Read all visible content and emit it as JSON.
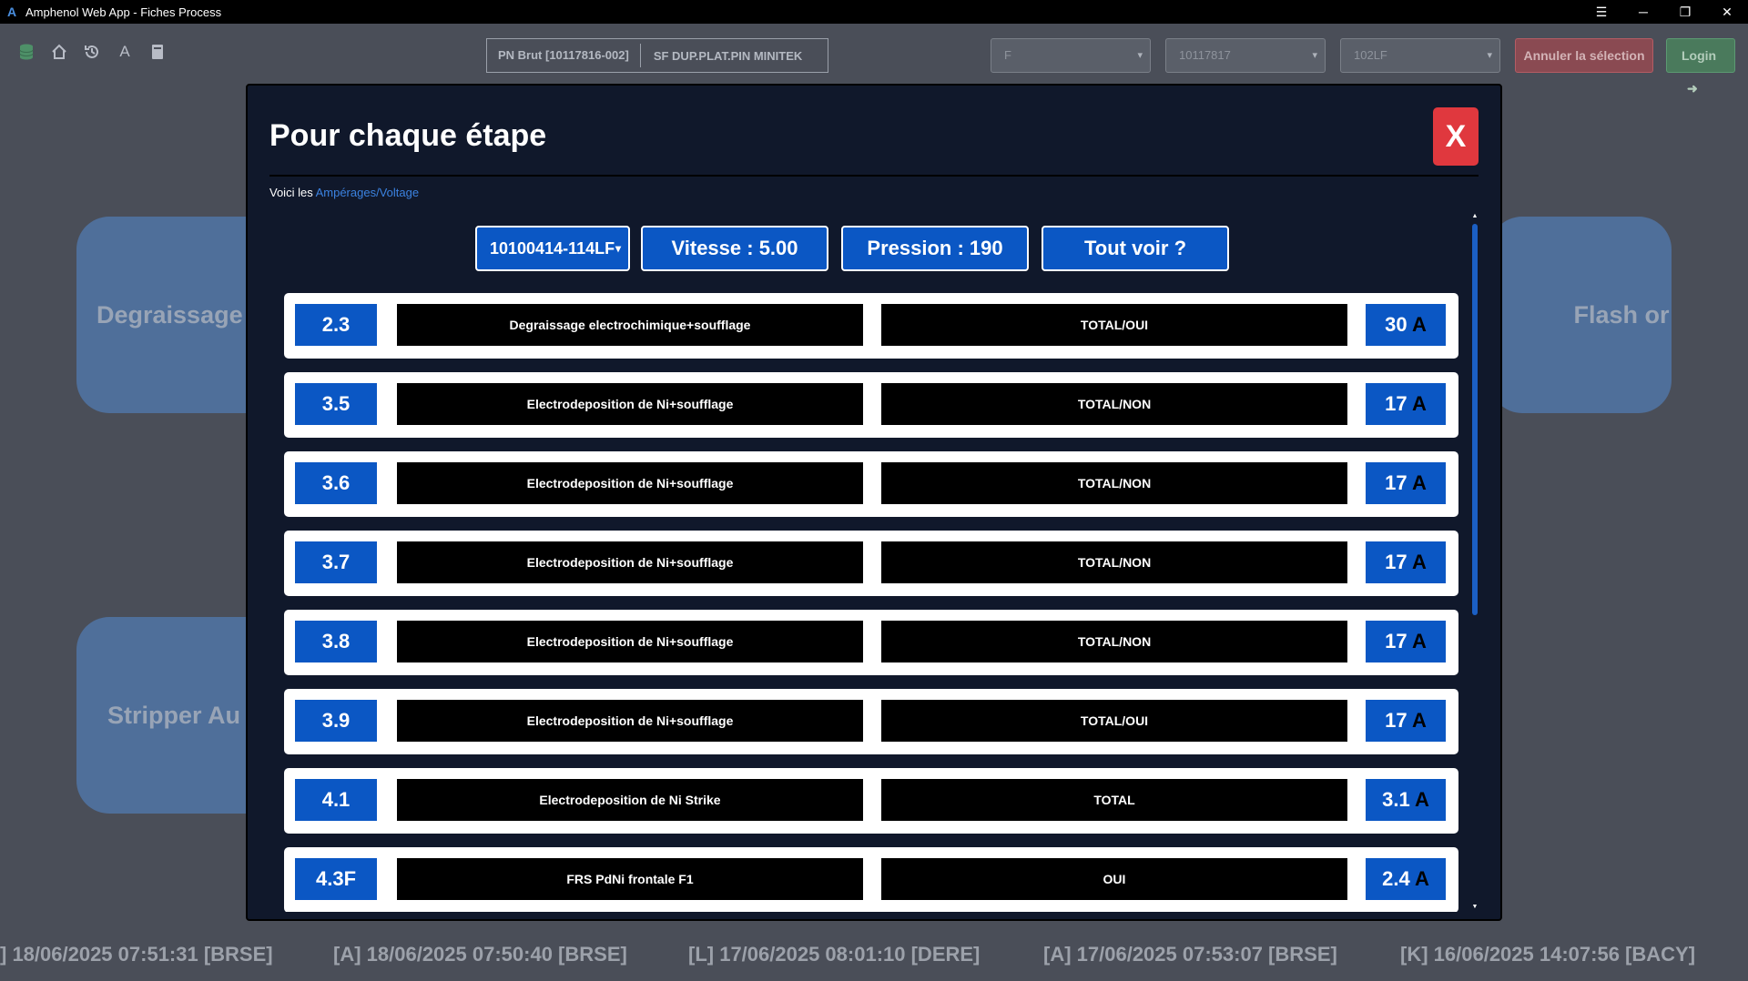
{
  "window": {
    "title": "Amphenol Web App - Fiches Process",
    "logo": "A"
  },
  "toolbar": {
    "icons": [
      "database-icon",
      "home-icon",
      "history-icon",
      "font-icon",
      "book-icon"
    ],
    "font_icon_label": "A",
    "pn_brut": "PN Brut [10117816-002]",
    "pn_desc": "SF DUP.PLAT.PIN MINITEK",
    "select_1": "F",
    "select_2": "10117817",
    "select_3": "102LF",
    "annuler_label": "Annuler la sélection",
    "login_label": "Login"
  },
  "background_cards": {
    "degraissage": "Degraissage",
    "stripper": "Stripper Au",
    "flash": "Flash or"
  },
  "ticker": [
    "] 18/06/2025 07:51:31 [BRSE]",
    "[A] 18/06/2025 07:50:40 [BRSE]",
    "[L] 17/06/2025 08:01:10 [DERE]",
    "[A] 17/06/2025 07:53:07 [BRSE]",
    "[K] 16/06/2025 14:07:56 [BACY]"
  ],
  "modal": {
    "title": "Pour chaque étape",
    "close_label": "X",
    "intro_text": "Voici les ",
    "intro_link": "Ampérages/Voltage",
    "dropdown_value": "10100414-114LF",
    "vitesse": "Vitesse : 5.00",
    "pression": "Pression : 190",
    "tout_voir": "Tout voir ?",
    "amp_unit": "A",
    "rows": [
      {
        "num": "2.3",
        "desc": "Degraissage electrochimique+soufflage",
        "mode": "TOTAL/OUI",
        "amp": "30"
      },
      {
        "num": "3.5",
        "desc": "Electrodeposition de Ni+soufflage",
        "mode": "TOTAL/NON",
        "amp": "17"
      },
      {
        "num": "3.6",
        "desc": "Electrodeposition de Ni+soufflage",
        "mode": "TOTAL/NON",
        "amp": "17"
      },
      {
        "num": "3.7",
        "desc": "Electrodeposition de Ni+soufflage",
        "mode": "TOTAL/NON",
        "amp": "17"
      },
      {
        "num": "3.8",
        "desc": "Electrodeposition de Ni+soufflage",
        "mode": "TOTAL/NON",
        "amp": "17"
      },
      {
        "num": "3.9",
        "desc": "Electrodeposition de Ni+soufflage",
        "mode": "TOTAL/OUI",
        "amp": "17"
      },
      {
        "num": "4.1",
        "desc": "Electrodeposition de Ni Strike",
        "mode": "TOTAL",
        "amp": "3.1"
      },
      {
        "num": "4.3F",
        "desc": "FRS PdNi frontale F1",
        "mode": "OUI",
        "amp": "2.4"
      }
    ]
  }
}
